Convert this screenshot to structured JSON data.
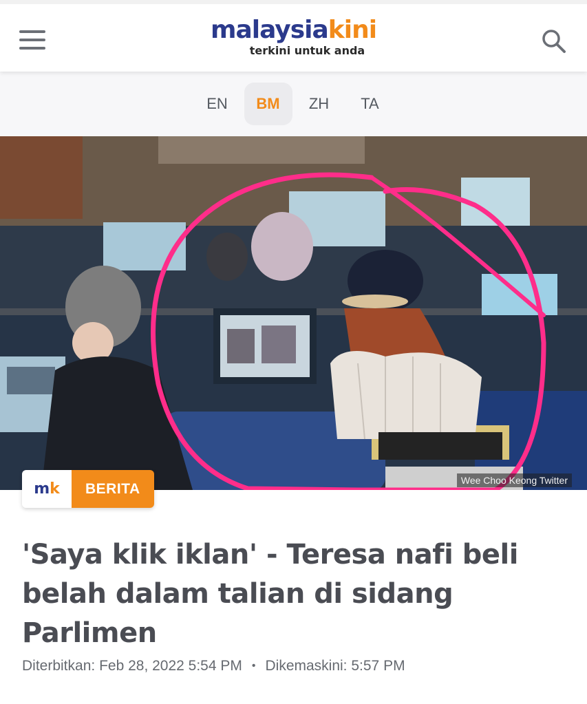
{
  "header": {
    "logo_part1": "malaysia",
    "logo_part2": "kini",
    "tagline": "terkini untuk anda",
    "menu_icon": "hamburger-menu-icon",
    "search_icon": "search-icon"
  },
  "languages": [
    {
      "label": "EN",
      "active": false
    },
    {
      "label": "BM",
      "active": true
    },
    {
      "label": "ZH",
      "active": false
    },
    {
      "label": "TA",
      "active": false
    }
  ],
  "hero": {
    "photo_credit": "Wee Choo Keong  Twitter"
  },
  "badge": {
    "logo_m": "m",
    "logo_k": "k",
    "category": "BERITA"
  },
  "article": {
    "title": "'Saya klik iklan' - Teresa nafi beli belah dalam talian di sidang Parlimen",
    "published_label": "Diterbitkan:",
    "published_value": "Feb 28, 2022 5:54 PM",
    "separator": "•",
    "updated_label": "Dikemaskini:",
    "updated_value": "5:57 PM"
  },
  "colors": {
    "brand_blue": "#2b3a8c",
    "brand_orange": "#f28b1a",
    "highlight_circle": "#ff2d8a"
  }
}
